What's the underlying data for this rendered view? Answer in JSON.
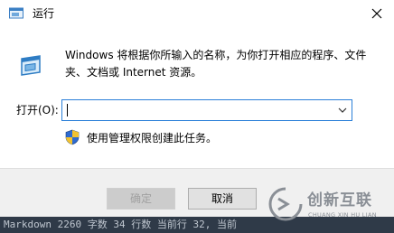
{
  "window": {
    "title": "运行",
    "close_symbol": "✕"
  },
  "main": {
    "description": "Windows 将根据你所输入的名称，为你打开相应的程序、文件夹、文档或 Internet 资源。",
    "open_label": "打开(O):",
    "open_value": "",
    "admin_text": "使用管理权限创建此任务。"
  },
  "buttons": {
    "ok_label": "确定",
    "cancel_label": "取消"
  },
  "overlay": {
    "text": "Markdown  2260 字数  34 行数  当前行 32, 当前"
  },
  "watermark": {
    "title": "创新互联",
    "subtitle": "CHUANG XIN HU LIAN"
  },
  "icons": {
    "title": "run-icon",
    "app": "run-app-icon",
    "shield": "uac-shield-icon",
    "close": "close-icon",
    "dropdown": "chevron-down-icon"
  },
  "colors": {
    "focus_border": "#2a7fd8",
    "footer_bg": "#f0f0f0"
  }
}
